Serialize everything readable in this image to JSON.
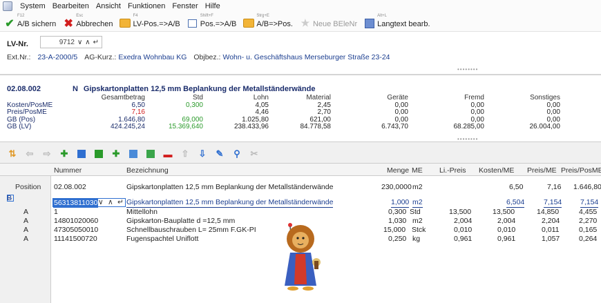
{
  "menu": [
    "System",
    "Bearbeiten",
    "Ansicht",
    "Funktionen",
    "Fenster",
    "Hilfe"
  ],
  "toolbar": [
    {
      "label": "A/B sichern",
      "hotkey": "F12",
      "icon": "check-icon"
    },
    {
      "label": "Abbrechen",
      "hotkey": "Esc",
      "icon": "cancel-x-icon"
    },
    {
      "label": "LV-Pos.=>A/B",
      "hotkey": "F4",
      "icon": "folder-icon"
    },
    {
      "label": "Pos.=>A/B",
      "hotkey": "Shift+F",
      "icon": "position-box-icon"
    },
    {
      "label": "A/B=>Pos.",
      "hotkey": "Strg+E",
      "icon": "folder-icon"
    },
    {
      "label": "Neue BEleNr",
      "hotkey": "",
      "icon": "star-icon"
    },
    {
      "label": "Langtext bearb.",
      "hotkey": "Alt+L",
      "icon": "document-icon"
    }
  ],
  "header": {
    "lv_label": "LV-Nr.",
    "lv_value": "9712",
    "ext_label": "Ext.Nr.:",
    "ext_value": "23-A-2000/5",
    "ag_label": "AG-Kurz.:",
    "ag_value": "Exedra Wohnbau KG",
    "obj_label": "Objbez.:",
    "obj_value": "Wohn- u. Geschäftshaus Merseburger Straße 23-24"
  },
  "calc": {
    "pos_nr": "02.08.002",
    "flag": "N",
    "title": "Gipskartonplatten 12,5 mm Beplankung der Metallständerwände",
    "columns": [
      "Gesamtbetrag",
      "Std",
      "Lohn",
      "Material",
      "Geräte",
      "Fremd",
      "Sonstiges"
    ],
    "rows": [
      {
        "label": "Kosten/PosME",
        "values": [
          "6,50",
          "0,300",
          "4,05",
          "2,45",
          "0,00",
          "0,00",
          "0,00"
        ]
      },
      {
        "label": "Preis/PosME",
        "values": [
          "7,16",
          "",
          "4,46",
          "2,70",
          "0,00",
          "0,00",
          "0,00"
        ]
      },
      {
        "label": "GB (Pos)",
        "values": [
          "1.646,80",
          "69,000",
          "1.025,80",
          "621,00",
          "0,00",
          "0,00",
          "0,00"
        ]
      },
      {
        "label": "GB (LV)",
        "values": [
          "424.245,24",
          "15.369,640",
          "238.433,96",
          "84.778,58",
          "6.743,70",
          "68.285,00",
          "26.004,00"
        ]
      }
    ]
  },
  "grid": {
    "columns": [
      "Nummer",
      "Bezeichnung",
      "Menge",
      "ME",
      "Li.-Preis",
      "Kosten/ME",
      "Preis/ME",
      "Preis/PosME"
    ],
    "position_row": {
      "side": "Position",
      "nummer": "02.08.002",
      "bez": "Gipskartonplatten 12,5 mm Beplankung der Metallständerwände",
      "menge": "230,0000",
      "me": "m2",
      "li": "",
      "kosten": "6,50",
      "preis": "7,16",
      "preis_pos": "1.646,80"
    },
    "b_row": {
      "side": "B",
      "nummer": "56313811030",
      "bez": "Gipskartonplatten 12,5 mm Beplankung der Metallständerwände",
      "menge": "1,000",
      "me": "m2",
      "li": "",
      "kosten": "6,504",
      "preis": "7,154",
      "preis_pos": "7,154"
    },
    "rows": [
      {
        "side": "A",
        "nummer": "1",
        "bez": "Mittellohn",
        "menge": "0,300",
        "me": "Std",
        "li": "13,500",
        "kosten": "13,500",
        "preis": "14,850",
        "preis_pos": "4,455"
      },
      {
        "side": "A",
        "nummer": "14801020060",
        "bez": "Gipskarton-Bauplatte d =12,5 mm",
        "menge": "1,030",
        "me": "m2",
        "li": "2,004",
        "kosten": "2,004",
        "preis": "2,204",
        "preis_pos": "2,270"
      },
      {
        "side": "A",
        "nummer": "47305050010",
        "bez": "Schnellbauschrauben L= 25mm F.GK-PI",
        "menge": "15,000",
        "me": "Stck",
        "li": "0,010",
        "kosten": "0,010",
        "preis": "0,011",
        "preis_pos": "0,165"
      },
      {
        "side": "A",
        "nummer": "11141500720",
        "bez": "Fugenspachtel Uniflott",
        "menge": "0,250",
        "me": "kg",
        "li": "0,961",
        "kosten": "0,961",
        "preis": "1,057",
        "preis_pos": "0,264"
      }
    ]
  },
  "colors": {
    "accent": "#2f6fd0",
    "title_blue": "#1a2c6b",
    "red": "#d21e1e",
    "green": "#2a9a2a"
  }
}
